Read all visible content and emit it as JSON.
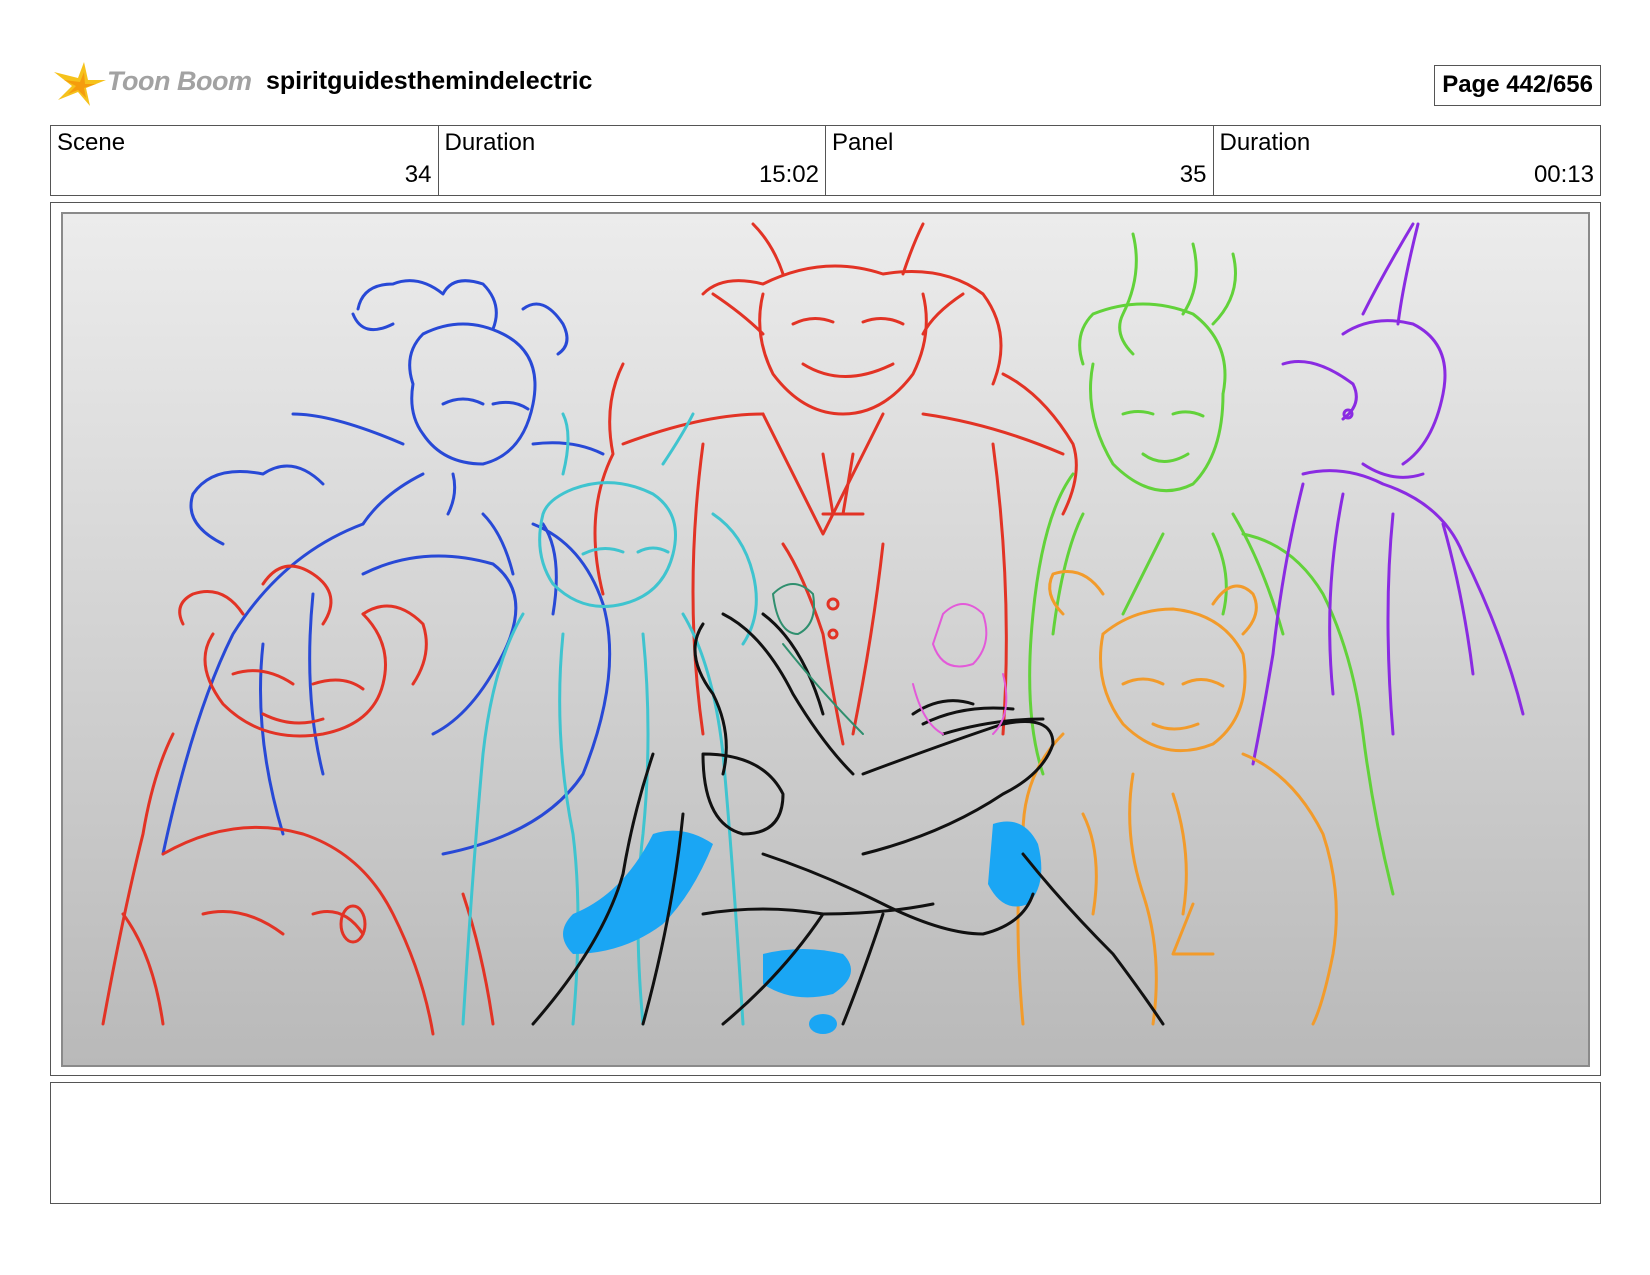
{
  "header": {
    "logo_text": "Toon Boom",
    "project_title": "spiritguidesthemindelectric",
    "page_label": "Page 442/656"
  },
  "info": {
    "scene_label": "Scene",
    "scene_value": "34",
    "scene_duration_label": "Duration",
    "scene_duration_value": "15:02",
    "panel_label": "Panel",
    "panel_value": "35",
    "panel_duration_label": "Duration",
    "panel_duration_value": "00:13"
  },
  "panel_sketch": {
    "icon": "storyboard-sketch",
    "line_colors": {
      "blue_character": "#2849d6",
      "red_character": "#e23325",
      "green_character": "#62d23a",
      "purple_character": "#8a2be2",
      "orange_character": "#f29b2b",
      "cyan_character": "#3fc4cf",
      "hands": "#111111",
      "fill_blue": "#1aa6f4"
    }
  },
  "notes": {
    "text": ""
  }
}
